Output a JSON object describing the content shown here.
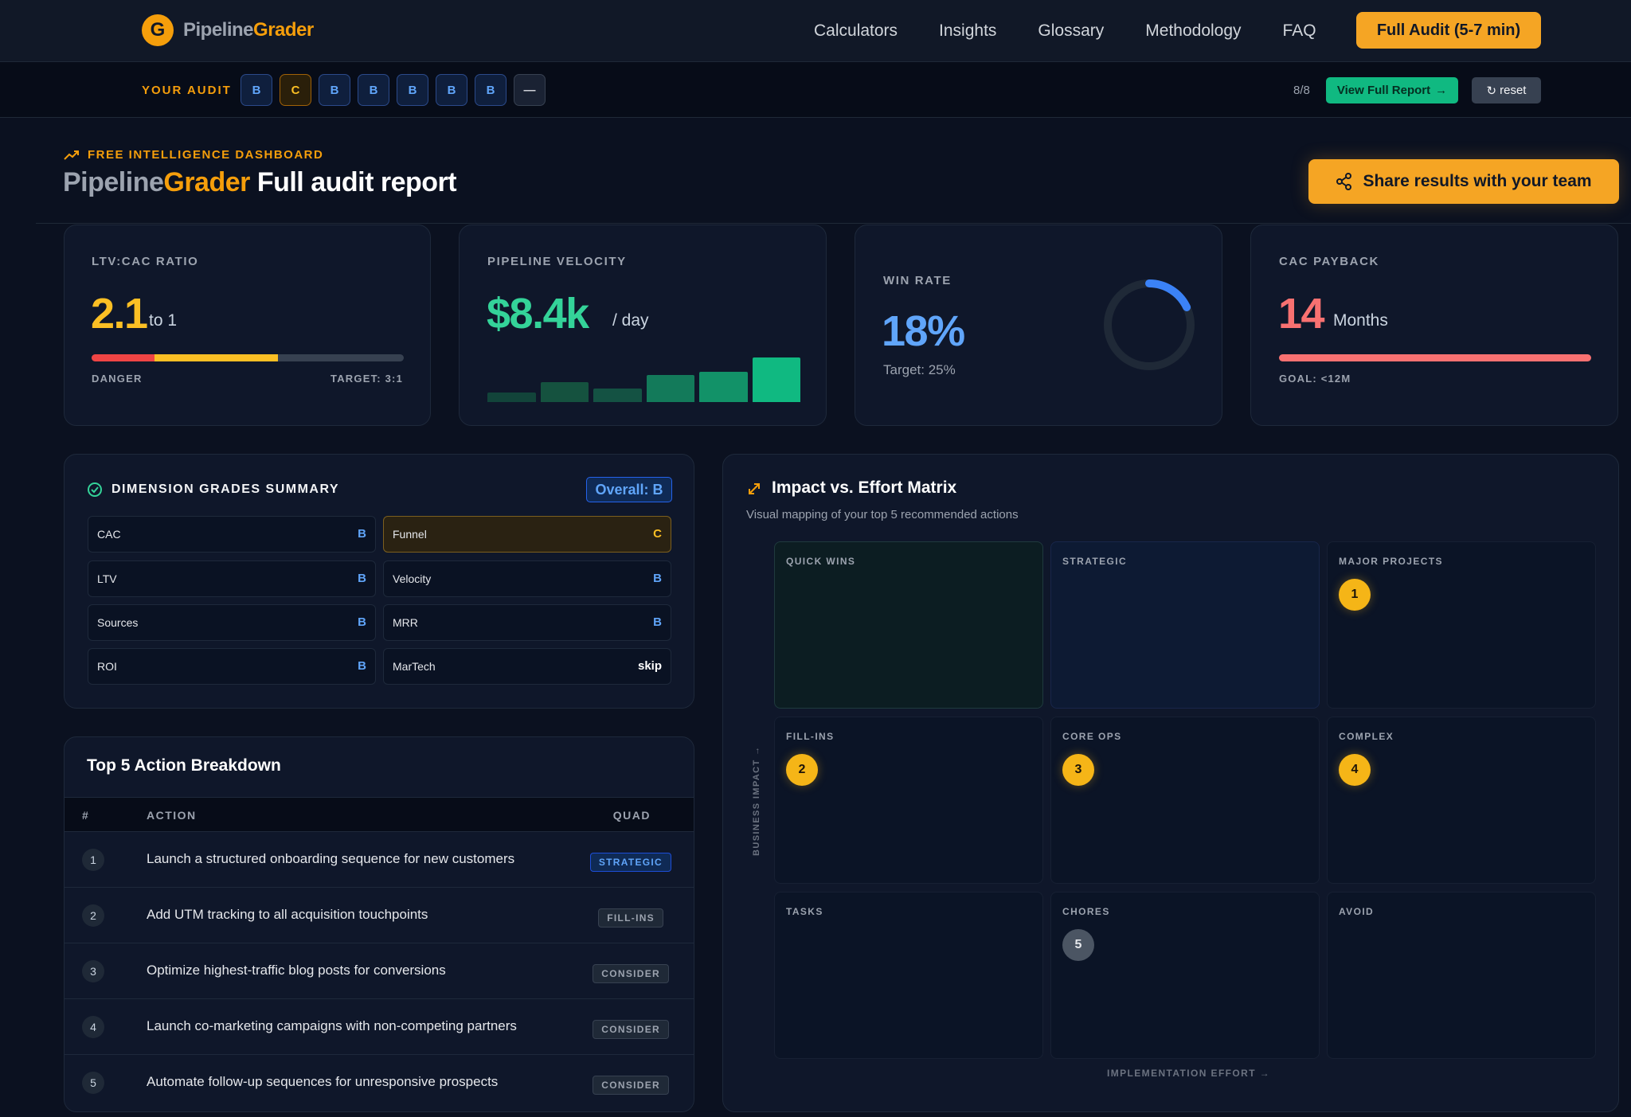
{
  "nav": {
    "logo_letter": "G",
    "logo_part1": "Pipeline",
    "logo_part2": "Grader",
    "links": [
      "Calculators",
      "Insights",
      "Glossary",
      "Methodology",
      "FAQ"
    ],
    "cta": "Full Audit (5-7 min)"
  },
  "audit_bar": {
    "label": "YOUR AUDIT",
    "chips": [
      "B",
      "C",
      "B",
      "B",
      "B",
      "B",
      "B",
      "—"
    ],
    "progress": "8/8",
    "view_report": "View Full Report",
    "reset": "reset"
  },
  "header": {
    "eyebrow": "FREE INTELLIGENCE DASHBOARD",
    "title_part1": "Pipeline",
    "title_part2": "Grader",
    "title_part3": " Full audit report",
    "share": "Share results with your team"
  },
  "metrics": {
    "ltv_cac": {
      "label": "LTV:CAC RATIO",
      "value": "2.1",
      "unit": "to 1",
      "left_caption": "DANGER",
      "right_caption": "TARGET: 3:1",
      "value_color": "#fbbf24"
    },
    "velocity": {
      "label": "PIPELINE VELOCITY",
      "value": "$8.4k",
      "unit": "/ day",
      "value_color": "#34d399",
      "bars": [
        0.2,
        0.4,
        0.28,
        0.55,
        0.62,
        0.9
      ]
    },
    "win_rate": {
      "label": "WIN RATE",
      "value": "18%",
      "target": "Target: 25%",
      "fraction": 0.18,
      "value_color": "#60a5fa"
    },
    "cac_payback": {
      "label": "CAC PAYBACK",
      "value": "14",
      "unit": "Months",
      "caption": "GOAL: <12M",
      "value_color": "#f87171"
    }
  },
  "grades": {
    "title": "DIMENSION GRADES SUMMARY",
    "overall": "Overall: B",
    "rows": [
      {
        "name": "CAC",
        "grade": "B"
      },
      {
        "name": "Funnel",
        "grade": "C"
      },
      {
        "name": "LTV",
        "grade": "B"
      },
      {
        "name": "Velocity",
        "grade": "B"
      },
      {
        "name": "Sources",
        "grade": "B"
      },
      {
        "name": "MRR",
        "grade": "B"
      },
      {
        "name": "ROI",
        "grade": "B"
      },
      {
        "name": "MarTech",
        "grade": "skip"
      }
    ]
  },
  "actions": {
    "title": "Top 5 Action Breakdown",
    "headers": [
      "#",
      "ACTION",
      "QUAD"
    ],
    "rows": [
      {
        "num": "1",
        "action": "Launch a structured onboarding sequence for new customers",
        "quad": "STRATEGIC"
      },
      {
        "num": "2",
        "action": "Add UTM tracking to all acquisition touchpoints",
        "quad": "FILL-INS"
      },
      {
        "num": "3",
        "action": "Optimize highest-traffic blog posts for conversions",
        "quad": "CONSIDER"
      },
      {
        "num": "4",
        "action": "Launch co-marketing campaigns with non-competing partners",
        "quad": "CONSIDER"
      },
      {
        "num": "5",
        "action": "Automate follow-up sequences for unresponsive prospects",
        "quad": "CONSIDER"
      }
    ]
  },
  "matrix": {
    "title": "Impact vs. Effort Matrix",
    "subtitle": "Visual mapping of your top 5 recommended actions",
    "y_axis": "BUSINESS IMPACT →",
    "x_axis": "IMPLEMENTATION EFFORT →",
    "cells": [
      {
        "label": "QUICK WINS",
        "item": ""
      },
      {
        "label": "STRATEGIC",
        "item": ""
      },
      {
        "label": "MAJOR PROJECTS",
        "item": "1"
      },
      {
        "label": "FILL-INS",
        "item": "2"
      },
      {
        "label": "CORE OPS",
        "item": "3"
      },
      {
        "label": "COMPLEX",
        "item": "4"
      },
      {
        "label": "TASKS",
        "item": ""
      },
      {
        "label": "CHORES",
        "item": "5"
      },
      {
        "label": "AVOID",
        "item": ""
      }
    ]
  }
}
